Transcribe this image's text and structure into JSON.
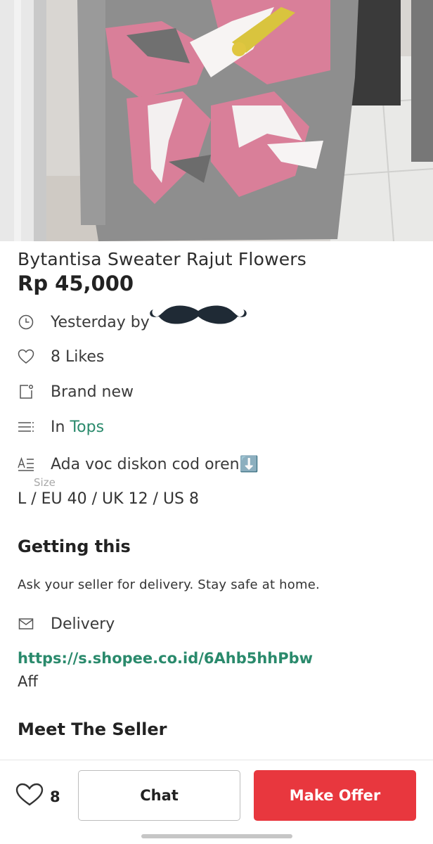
{
  "product": {
    "title": "Bytantisa Sweater Rajut Flowers",
    "price": "Rp 45,000"
  },
  "details": {
    "posted": "Yesterday by",
    "likes": "8 Likes",
    "condition": "Brand new",
    "category_prefix": "In ",
    "category": "Tops",
    "description": "Ada voc diskon cod oren⬇️",
    "size_label": "Size",
    "size_value": "L / EU 40 / UK 12 / US 8"
  },
  "getting": {
    "heading": "Getting this",
    "note": "Ask your seller for delivery. Stay safe at home.",
    "delivery": "Delivery",
    "link": "https://s.shopee.co.id/6Ahb5hhPbw",
    "aff": "Aff"
  },
  "seller": {
    "heading": "Meet The Seller"
  },
  "bottom_bar": {
    "like_count": "8",
    "chat_label": "Chat",
    "offer_label": "Make Offer"
  },
  "colors": {
    "accent_green": "#2a8a6c",
    "offer_red": "#e8373e"
  },
  "icons": [
    "clock-icon",
    "heart-icon",
    "tag-icon",
    "list-icon",
    "text-icon",
    "mail-icon",
    "heart-outline-icon"
  ]
}
